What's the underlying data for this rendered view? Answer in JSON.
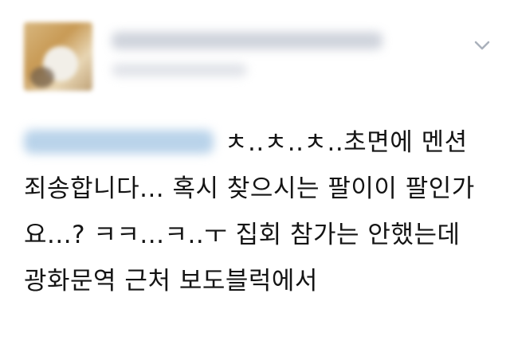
{
  "tweet": {
    "author": {
      "avatar_icon": "avatar-icon"
    },
    "menu": {
      "icon": "chevron-down-icon",
      "color": "#aab1bb"
    },
    "text": "ㅊ..ㅊ..ㅊ..초면에 멘션 죄송합니다... 혹시 찾으시는 팔이이 팔인가요...? ㅋㅋ...ㅋ..ㅜ 집회 참가는 안했는데 광화문역 근처 보도블럭에서"
  }
}
